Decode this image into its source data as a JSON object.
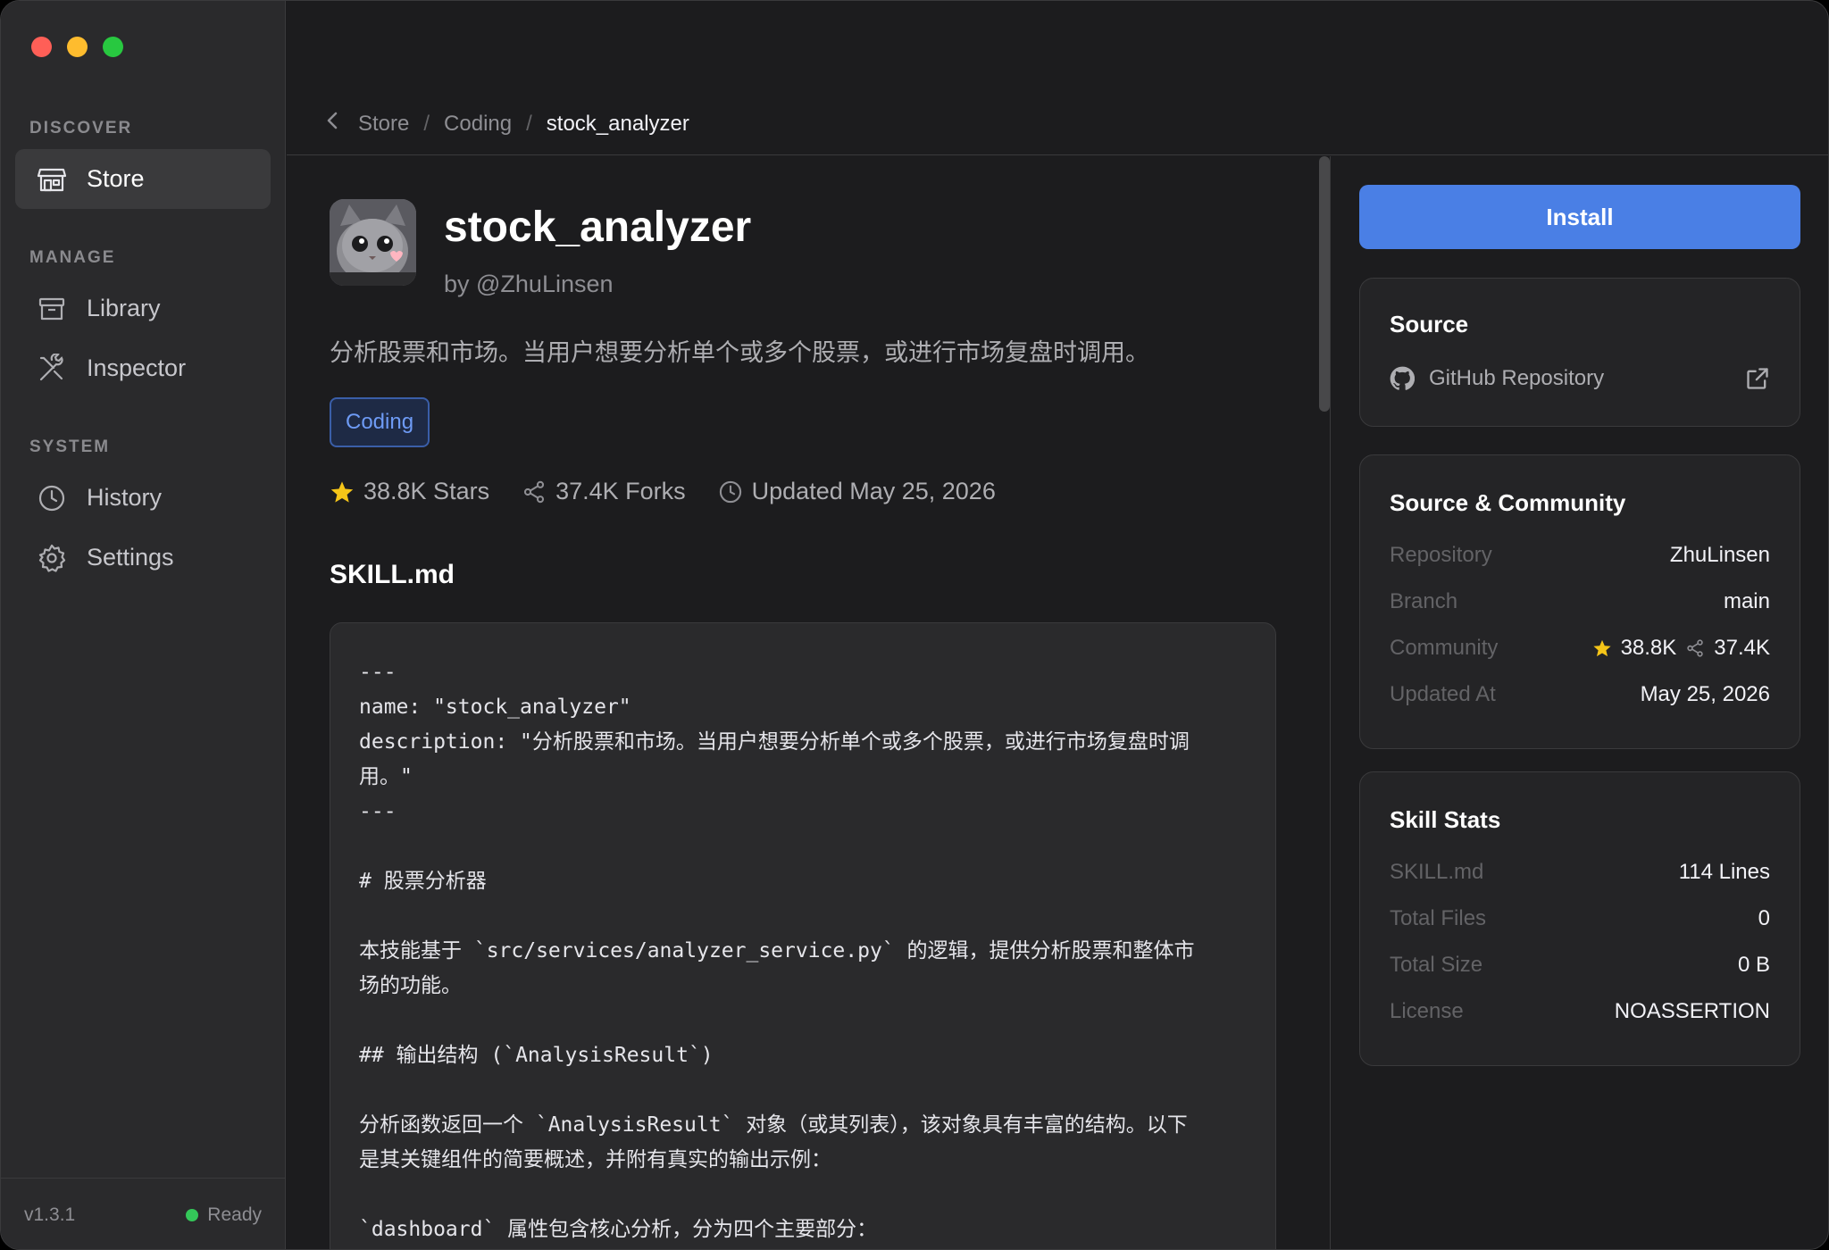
{
  "sidebar": {
    "sections": {
      "discover": "DISCOVER",
      "manage": "MANAGE",
      "system": "SYSTEM"
    },
    "items": {
      "store": "Store",
      "library": "Library",
      "inspector": "Inspector",
      "history": "History",
      "settings": "Settings"
    },
    "active_item": "Store",
    "version": "v1.3.1",
    "status": "Ready",
    "status_color": "#34c759"
  },
  "breadcrumb": {
    "items": [
      "Store",
      "Coding",
      "stock_analyzer"
    ],
    "separator": "/"
  },
  "skill": {
    "name": "stock_analyzer",
    "author": "by @ZhuLinsen",
    "description": "分析股票和市场。当用户想要分析单个或多个股票，或进行市场复盘时调用。",
    "tag": "Coding",
    "stars": "38.8K Stars",
    "forks": "37.4K Forks",
    "updated": "Updated May 25, 2026"
  },
  "skill_md": {
    "heading": "SKILL.md",
    "lines": [
      "---",
      "name: \"stock_analyzer\"",
      "description: \"分析股票和市场。当用户想要分析单个或多个股票，或进行市场复盘时调",
      "用。\"",
      "---",
      "",
      "# 股票分析器",
      "",
      "本技能基于 `src/services/analyzer_service.py` 的逻辑，提供分析股票和整体市",
      "场的功能。",
      "",
      "## 输出结构 (`AnalysisResult`)",
      "",
      "分析函数返回一个 `AnalysisResult` 对象（或其列表），该对象具有丰富的结构。以下",
      "是其关键组件的简要概述，并附有真实的输出示例：",
      "",
      "`dashboard` 属性包含核心分析，分为四个主要部分："
    ]
  },
  "install_button": "Install",
  "source_card": {
    "title": "Source",
    "link_label": "GitHub Repository"
  },
  "community_card": {
    "title": "Source & Community",
    "rows": {
      "repository_k": "Repository",
      "repository_v": "ZhuLinsen",
      "branch_k": "Branch",
      "branch_v": "main",
      "community_k": "Community",
      "community_stars": "38.8K",
      "community_forks": "37.4K",
      "updated_k": "Updated At",
      "updated_v": "May 25, 2026"
    }
  },
  "stats_card": {
    "title": "Skill Stats",
    "rows": {
      "skillmd_k": "SKILL.md",
      "skillmd_v": "114 Lines",
      "files_k": "Total Files",
      "files_v": "0",
      "size_k": "Total Size",
      "size_v": "0 B",
      "license_k": "License",
      "license_v": "NOASSERTION"
    }
  },
  "colors": {
    "accent": "#4a7fe5",
    "star": "#f5c518",
    "tag_text": "#6e9bf5"
  }
}
